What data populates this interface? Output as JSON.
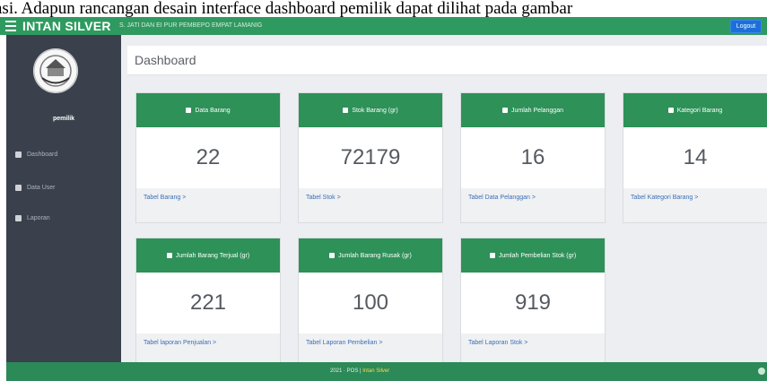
{
  "caption": "asi. Adapun rancangan desain interface dashboard pemilik dapat dilihat pada gambar",
  "topbar": {
    "menu_icon": "hamburger-icon",
    "brand": "INTAN SILVER",
    "subtitle": "S. JATI DAN EI PUR PEMBEPO EMPAT LAMANIG",
    "logout_label": "Logout"
  },
  "sidebar": {
    "username": "pemilik",
    "items": [
      {
        "icon": "home-icon",
        "label": "Dashboard"
      },
      {
        "icon": "users-icon",
        "label": "Data User"
      },
      {
        "icon": "file-icon",
        "label": "Laporan"
      }
    ]
  },
  "header": {
    "title": "Dashboard"
  },
  "cards": [
    {
      "icon": "monitor-icon",
      "title": "Data Barang",
      "value": "22",
      "link": "Tabel Barang >"
    },
    {
      "icon": "monitor-icon",
      "title": "Stok Barang (gr)",
      "value": "72179",
      "link": "Tabel Stok >"
    },
    {
      "icon": "bookmark-icon",
      "title": "Jumlah Pelanggan",
      "value": "16",
      "link": "Tabel Data Pelanggan >"
    },
    {
      "icon": "bookmark-icon",
      "title": "Kategori Barang",
      "value": "14",
      "link": "Tabel Kategori Barang >"
    },
    {
      "icon": "monitor-icon",
      "title": "Jumlah Barang Terjual (gr)",
      "value": "221",
      "link": "Tabel laporan Penjualan >"
    },
    {
      "icon": "warning-icon",
      "title": "Jumlah Barang Rusak (gr)",
      "value": "100",
      "link": "Tabel Laporan Pembelian >"
    },
    {
      "icon": "warning-icon",
      "title": "Jumlah Pembelian Stok (gr)",
      "value": "919",
      "link": "Tabel Laporan Stok >"
    }
  ],
  "footer": {
    "text": "2021 · POS | ",
    "brand": "Intan Silver"
  }
}
